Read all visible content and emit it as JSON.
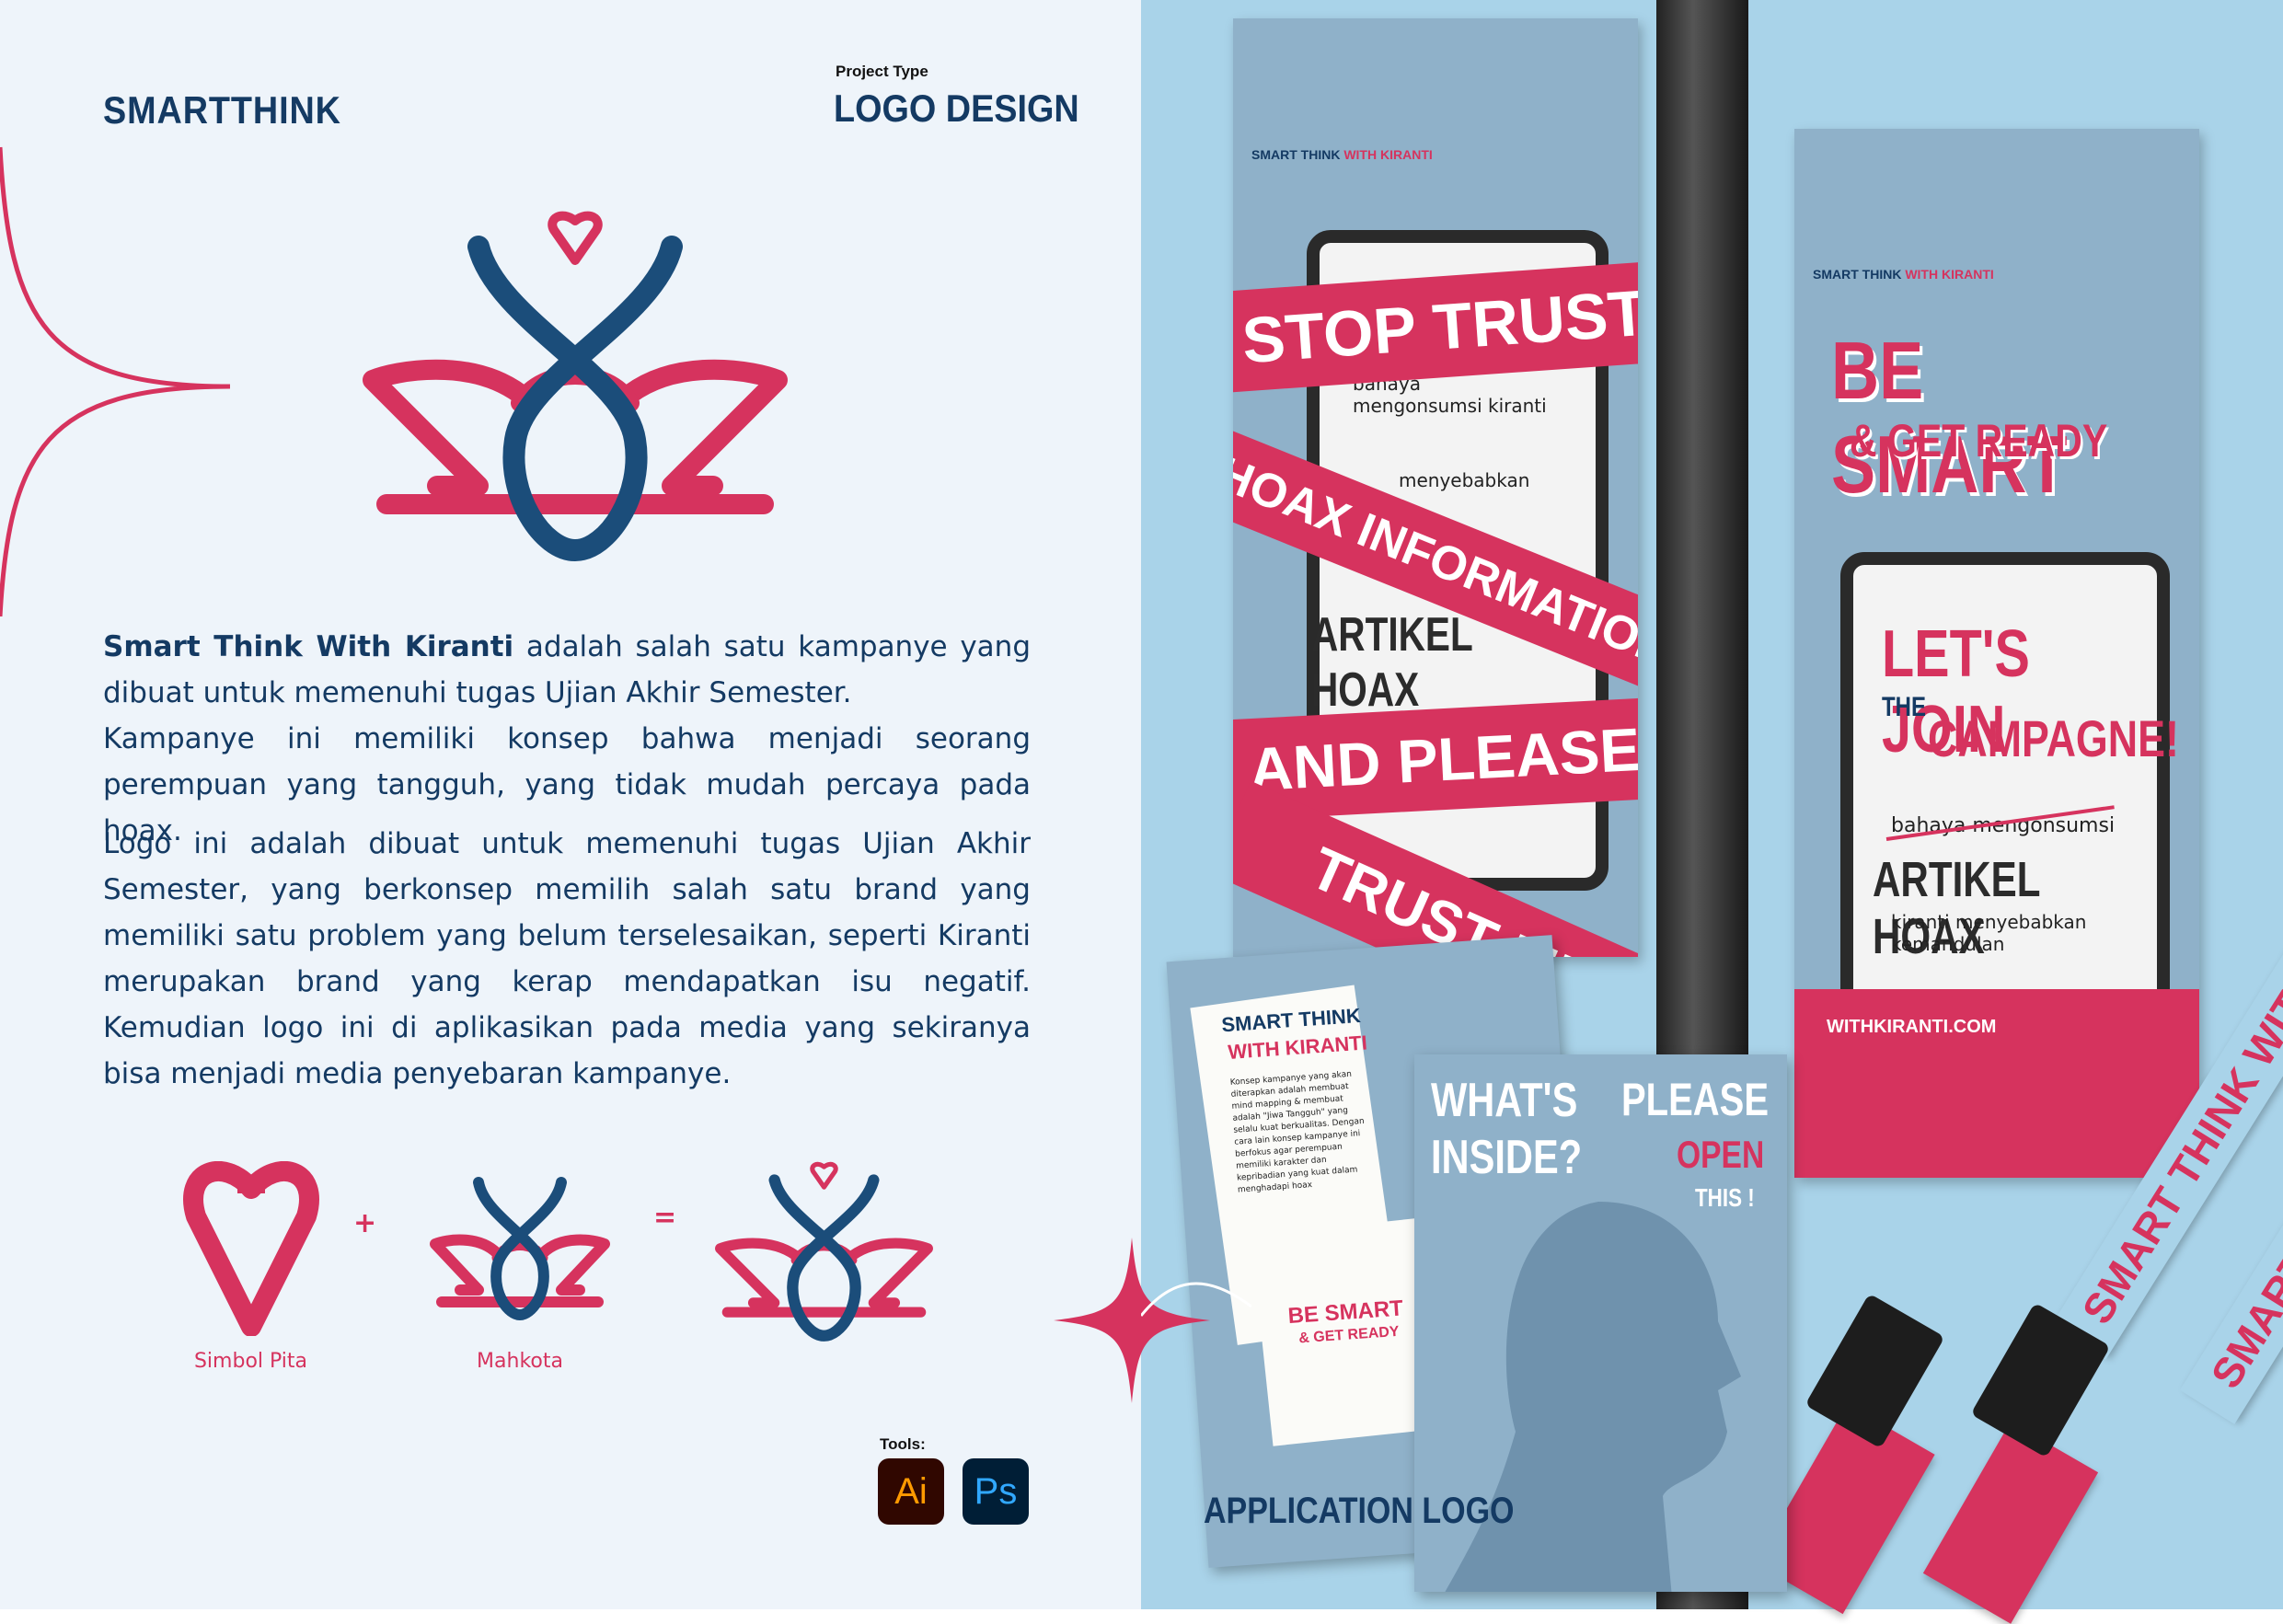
{
  "header": {
    "brand": "SMARTTHINK",
    "project_type_label": "Project Type",
    "project_type": "LOGO DESIGN"
  },
  "description": {
    "p1_bold": "Smart Think With Kiranti",
    "p1_rest": " adalah salah satu kampanye yang dibuat untuk memenuhi tugas Ujian Akhir Semester.",
    "p2": "Kampanye ini memiliki konsep bahwa menjadi seorang perempuan yang tangguh, yang tidak mudah percaya pada hoax.",
    "p3": "Logo ini adalah dibuat untuk memenuhi tugas Ujian Akhir Semester, yang berkonsep memilih salah satu brand yang memiliki satu problem yang belum terselesaikan, seperti Kiranti merupakan brand yang kerap mendapatkan isu negatif. Kemudian logo ini di aplikasikan pada media yang sekiranya bisa menjadi media penyebaran kampanye."
  },
  "formula": {
    "part1_caption": "Simbol Pita",
    "plus": "+",
    "part2_caption": "Mahkota",
    "equals": "="
  },
  "tools": {
    "label": "Tools:",
    "items": [
      "Ai",
      "Ps"
    ]
  },
  "application": {
    "label": "APPLICATION LOGO",
    "banner1": {
      "brand": "SMART THINK",
      "brand_accent": "WITH KIRANTI",
      "r1": "STOP TRUST",
      "r2": "HOAX INFORMATION",
      "r3": "AND PLEASE",
      "r4": "TRUST ME!",
      "small1": "bahaya mengonsumsi kiranti",
      "small2": "menyebabkan",
      "headline": "ARTIKEL HOAX"
    },
    "banner2": {
      "brand": "SMART THINK",
      "brand_accent": "WITH KIRANTI",
      "title1": "BE SMART",
      "title2": "& GET READY",
      "join1": "LET'S JOIN",
      "join2": "THE",
      "join3": "CAMPAGNE!",
      "small1": "bahaya mengonsumsi",
      "headline": "ARTIKEL HOAX",
      "small2": "kiranti menyebabkan kemandulan",
      "url": "WITHKIRANTI.COM"
    },
    "brochure": {
      "title1": "SMART THINK",
      "title2": "WITH KIRANTI",
      "body": "Konsep kampanye yang akan diterapkan adalah membuat mind mapping & membuat adalah \"Jiwa Tangguh\" yang selalu kuat berkualitas. Dengan cara lain konsep kampanye ini berfokus agar perempuan memiliki karakter dan kepribadian yang kuat dalam menghadapi hoax",
      "footer1": "BE SMART",
      "footer2": "& GET READY"
    },
    "poster": {
      "q1": "WHAT'S",
      "q2": "INSIDE?",
      "p1": "PLEASE",
      "p2": "OPEN",
      "p3": "THIS !"
    },
    "lanyard_text": "SMART THINK WITH KIRANTI"
  },
  "colors": {
    "navy": "#143a63",
    "pink": "#d6335e",
    "left_bg": "#eef4fa",
    "sky": "#a9d3e9"
  }
}
